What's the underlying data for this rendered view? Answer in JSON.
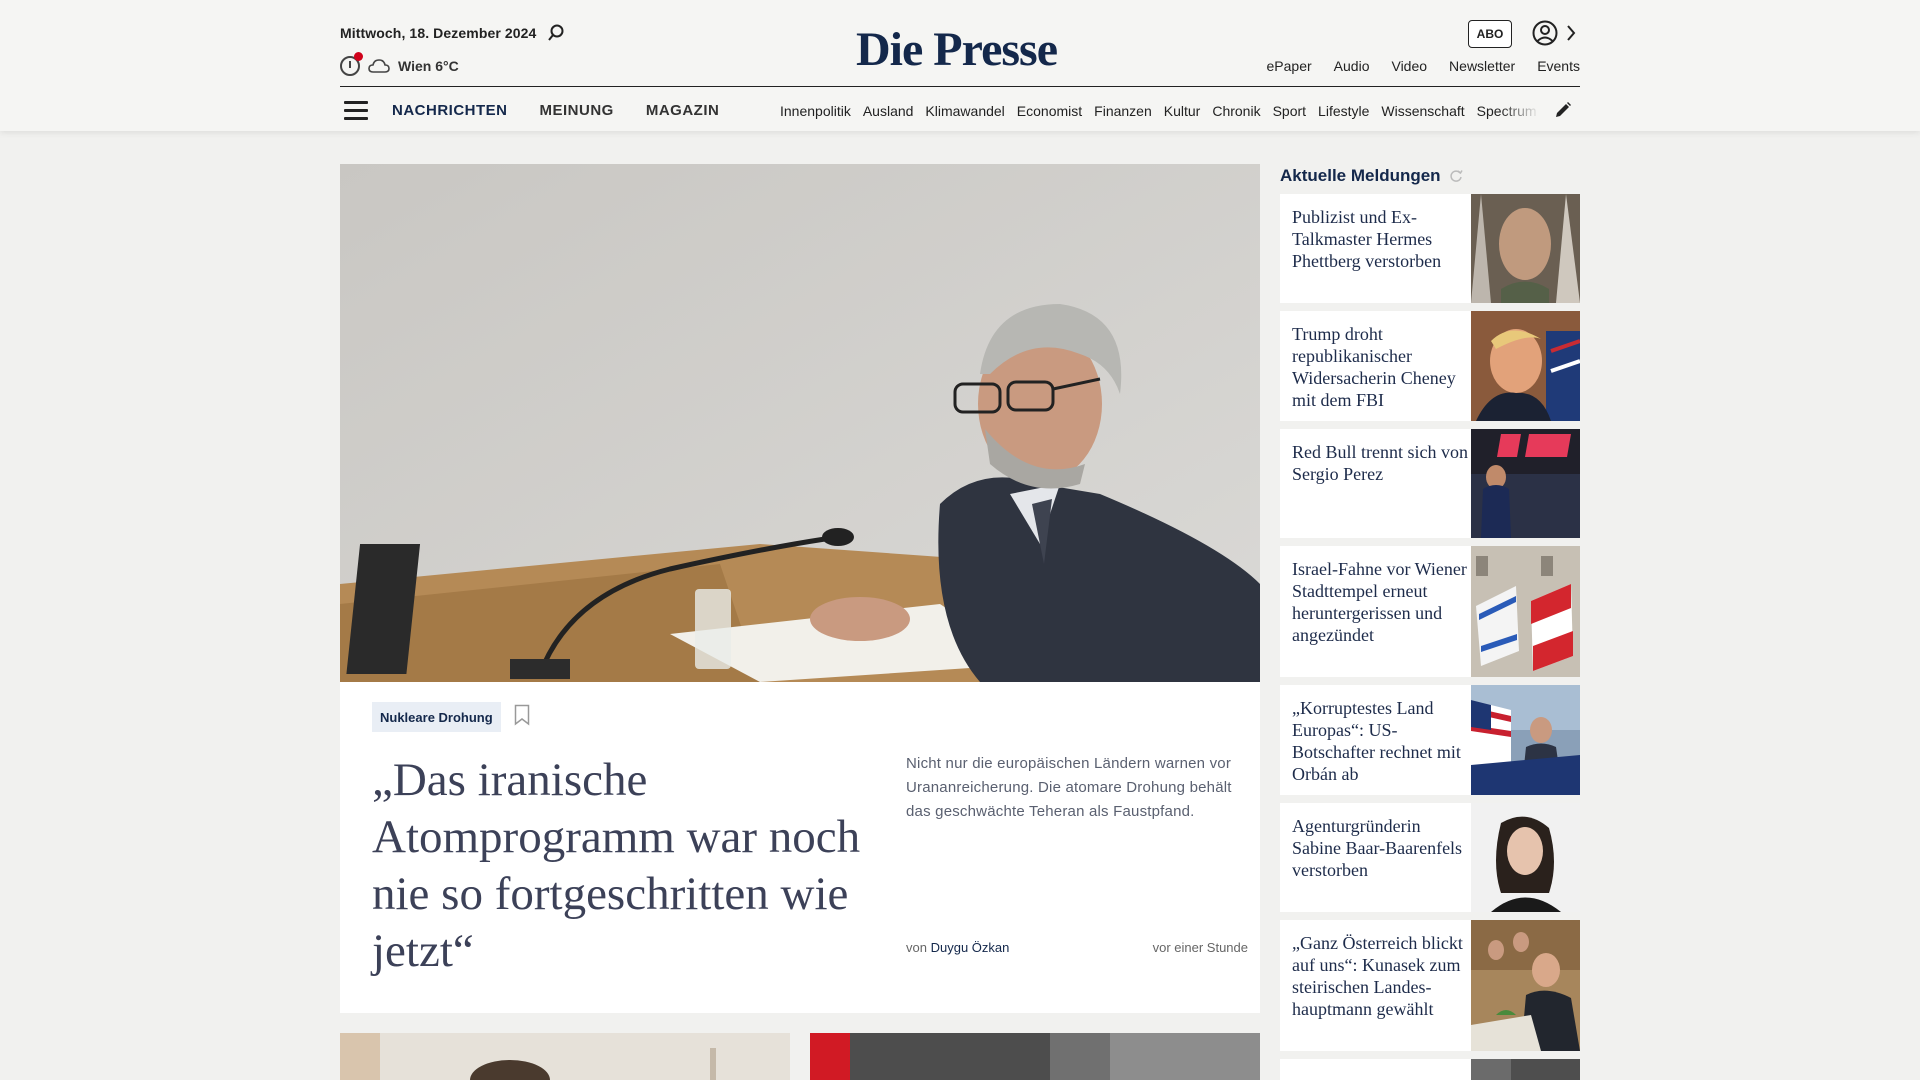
{
  "header": {
    "date": "Mittwoch, 18. Dezember 2024",
    "weather": "Wien 6°C",
    "logo": "Die Presse",
    "abo_label": "ABO",
    "top_links": [
      "ePaper",
      "Audio",
      "Video",
      "Newsletter",
      "Events"
    ]
  },
  "nav": {
    "main": [
      "NACHRICHTEN",
      "MEINUNG",
      "MAGAZIN"
    ],
    "sub": [
      "Innenpolitik",
      "Ausland",
      "Klimawandel",
      "Economist",
      "Finanzen",
      "Kultur",
      "Chronik",
      "Sport",
      "Lifestyle",
      "Wissenschaft",
      "Spectrum"
    ]
  },
  "hero": {
    "tag": "Nukleare Drohung",
    "headline": "„Das iranische Atomprogramm war noch nie so fortgeschritten wie jetzt“",
    "teaser": "Nicht nur die europäischen Ländern warnen vor Urananreicherung. Die atomare Drohung behält das geschwächte Teheran als Faustpfand.",
    "byline_prefix": "von",
    "author": "Duygu Özkan",
    "time_ago": "vor einer Stunde"
  },
  "sidebar": {
    "title": "Aktuelle Meldungen",
    "items": [
      {
        "text": "Publizist und Ex-Talkmaster Hermes Phettberg verstorben"
      },
      {
        "text": "Trump droht republikanischer Widersacherin Cheney mit dem FBI"
      },
      {
        "text": "Red Bull trennt sich von Sergio Perez"
      },
      {
        "text": "Israel-Fahne vor Wiener Stadttempel erneut heruntergerissen und angezündet"
      },
      {
        "text": "„Korruptestes Land Europas“: US-Botschafter rechnet mit Orbán ab"
      },
      {
        "text": "Agenturgründerin Sabine Baar-Baa­renfels verstorben"
      },
      {
        "text": "„Ganz Österreich blickt auf uns“: Kunasek zum steirischen Landes­hauptmann gewählt"
      }
    ]
  },
  "colors": {
    "brand": "#14284b",
    "background": "#f1f1ef",
    "alert_dot": "#d0021b"
  }
}
